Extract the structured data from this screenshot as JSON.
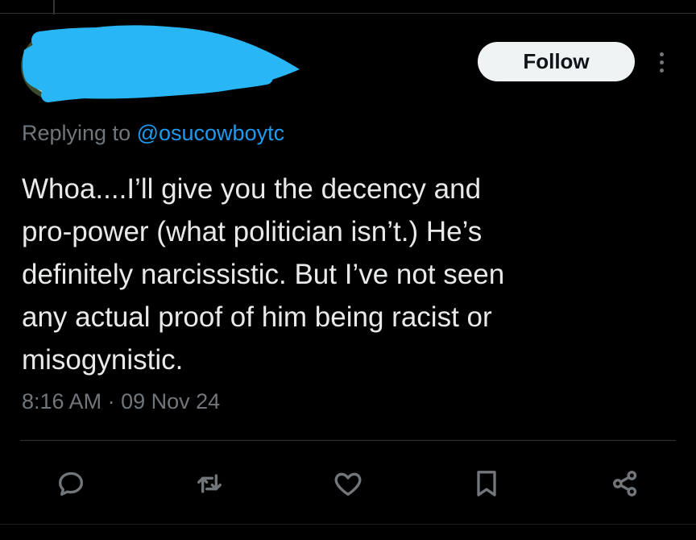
{
  "header": {
    "follow_label": "Follow",
    "avatar_icon": "profile-avatar",
    "redaction_color": "#29b6f6"
  },
  "reply": {
    "prefix": "Replying to ",
    "handle": "@osucowboytc"
  },
  "tweet": {
    "lines": [
      "Whoa....I’ll give you the decency and",
      "pro-power (what politician isn’t.) He’s",
      "definitely narcissistic. But I’ve not seen",
      "any actual proof of him being racist or",
      "misogynistic."
    ],
    "time": "8:16 AM",
    "separator": "·",
    "date": "09 Nov 24"
  },
  "actions": [
    {
      "name": "reply",
      "icon": "speech-bubble-icon"
    },
    {
      "name": "repost",
      "icon": "repost-icon"
    },
    {
      "name": "like",
      "icon": "heart-icon"
    },
    {
      "name": "bookmark",
      "icon": "bookmark-icon"
    },
    {
      "name": "share",
      "icon": "share-icon"
    }
  ],
  "colors": {
    "background": "#000000",
    "text": "#e7e9ea",
    "muted": "#71767b",
    "link": "#1d9bf0",
    "button_bg": "#eff3f4"
  }
}
